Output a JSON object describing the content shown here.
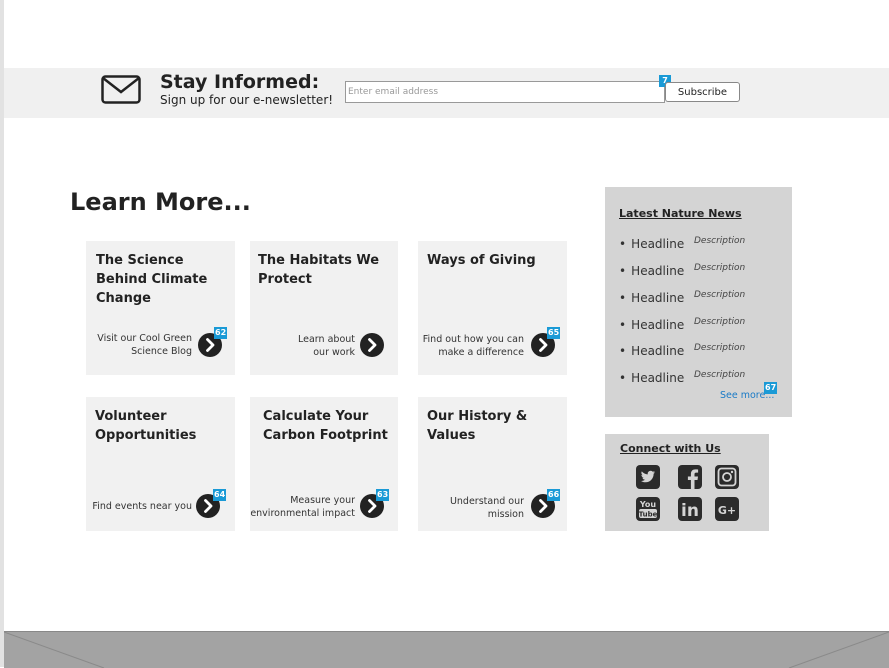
{
  "newsletter": {
    "icon": "envelope-icon",
    "title": "Stay Informed:",
    "subtitle": "Sign up for our e-newsletter!",
    "email_placeholder": "Enter email address",
    "email_badge": "7",
    "subscribe_label": "Subscribe"
  },
  "learn_more": {
    "title": "Learn More...",
    "cards": [
      {
        "title": "The Science Behind Climate Change",
        "link_line1": "Visit our Cool Green",
        "link_line2": "Science Blog",
        "badge": "62"
      },
      {
        "title": "The Habitats We Protect",
        "link_line1": "Learn about",
        "link_line2": "our work",
        "badge": ""
      },
      {
        "title": "Ways of Giving",
        "link_line1": "Find out how you can",
        "link_line2": "make a difference",
        "badge": "65"
      },
      {
        "title": "Volunteer Opportunities",
        "link_line1": "Find events near you",
        "link_line2": "",
        "badge": "64"
      },
      {
        "title": "Calculate Your Carbon Footprint",
        "link_line1": "Measure your",
        "link_line2": "environmental impact",
        "badge": "63"
      },
      {
        "title": "Our History & Values",
        "link_line1": "Understand our",
        "link_line2": "mission",
        "badge": "66"
      }
    ],
    "arrow_icon": "chevron-right-circle-icon"
  },
  "news": {
    "title": "Latest Nature News",
    "items": [
      {
        "bullet": "•",
        "headline": "Headline",
        "description": "Description"
      },
      {
        "bullet": "•",
        "headline": "Headline",
        "description": "Description"
      },
      {
        "bullet": "•",
        "headline": "Headline",
        "description": "Description"
      },
      {
        "bullet": "•",
        "headline": "Headline",
        "description": "Description"
      },
      {
        "bullet": "•",
        "headline": "Headline",
        "description": "Description"
      },
      {
        "bullet": "•",
        "headline": "Headline",
        "description": "Description"
      }
    ],
    "see_more": "See more...",
    "see_more_badge": "67"
  },
  "connect": {
    "title": "Connect with Us",
    "icons": [
      "twitter-icon",
      "facebook-icon",
      "instagram-icon",
      "youtube-icon",
      "linkedin-icon",
      "google-plus-icon"
    ],
    "youtube_text_top": "You",
    "youtube_text_bottom": "Tube",
    "linkedin_text": "in",
    "google_plus_text": "G+"
  },
  "colors": {
    "accent_badge": "#1a9ad6",
    "link": "#1a7ac6",
    "panel": "#d4d4d4",
    "card": "#f1f1f1",
    "footer": "#a3a3a3"
  }
}
